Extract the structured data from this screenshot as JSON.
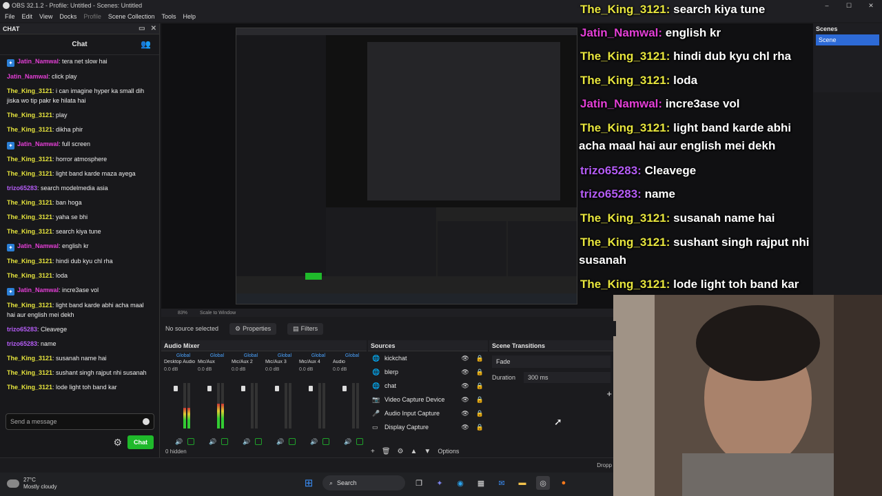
{
  "window": {
    "title": "OBS 32.1.2 - Profile: Untitled - Scenes: Untitled",
    "min": "–",
    "max": "☐",
    "close": "✕"
  },
  "menu": [
    "File",
    "Edit",
    "View",
    "Docks",
    "Profile",
    "Scene Collection",
    "Tools",
    "Help"
  ],
  "chat": {
    "dock_title": "CHAT",
    "title": "Chat",
    "messages": [
      {
        "user": "Jatin_Namwal",
        "text": "tera net slow hai",
        "color": "#e43fd6",
        "badge": true
      },
      {
        "user": "Jatin_Namwal",
        "text": "click play",
        "color": "#e43fd6",
        "badge": false
      },
      {
        "user": "The_King_3121",
        "text": "i can imagine hyper ka small dih jiska wo tip pakr ke hilata hai",
        "color": "#e7e53d",
        "badge": false
      },
      {
        "user": "The_King_3121",
        "text": "play",
        "color": "#e7e53d",
        "badge": false
      },
      {
        "user": "The_King_3121",
        "text": "dikha phir",
        "color": "#e7e53d",
        "badge": false
      },
      {
        "user": "Jatin_Namwal",
        "text": "full screen",
        "color": "#e43fd6",
        "badge": true
      },
      {
        "user": "The_King_3121",
        "text": "horror atmosphere",
        "color": "#e7e53d",
        "badge": false
      },
      {
        "user": "The_King_3121",
        "text": "light band karde maza ayega",
        "color": "#e7e53d",
        "badge": false
      },
      {
        "user": "trizo65283",
        "text": "search modelmedia asia",
        "color": "#b45cf5",
        "badge": false
      },
      {
        "user": "The_King_3121",
        "text": "ban hoga",
        "color": "#e7e53d",
        "badge": false
      },
      {
        "user": "The_King_3121",
        "text": "yaha se bhi",
        "color": "#e7e53d",
        "badge": false
      },
      {
        "user": "The_King_3121",
        "text": "search kiya tune",
        "color": "#e7e53d",
        "badge": false
      },
      {
        "user": "Jatin_Namwal",
        "text": "english kr",
        "color": "#e43fd6",
        "badge": true
      },
      {
        "user": "The_King_3121",
        "text": "hindi dub kyu chl rha",
        "color": "#e7e53d",
        "badge": false
      },
      {
        "user": "The_King_3121",
        "text": "loda",
        "color": "#e7e53d",
        "badge": false
      },
      {
        "user": "Jatin_Namwal",
        "text": "incre3ase vol",
        "color": "#e43fd6",
        "badge": true
      },
      {
        "user": "The_King_3121",
        "text": "light band karde abhi acha maal hai aur english mei dekh",
        "color": "#e7e53d",
        "badge": false
      },
      {
        "user": "trizo65283",
        "text": "Cleavege",
        "color": "#b45cf5",
        "badge": false
      },
      {
        "user": "trizo65283",
        "text": "name",
        "color": "#b45cf5",
        "badge": false
      },
      {
        "user": "The_King_3121",
        "text": "susanah name hai",
        "color": "#e7e53d",
        "badge": false
      },
      {
        "user": "The_King_3121",
        "text": "sushant singh rajput nhi susanah",
        "color": "#e7e53d",
        "badge": false
      },
      {
        "user": "The_King_3121",
        "text": "lode light toh band kar",
        "color": "#e7e53d",
        "badge": false
      }
    ],
    "input_placeholder": "Send a message",
    "send_label": "Chat"
  },
  "overlay": [
    {
      "user": "The_King_3121:",
      "text": "search kiya tune",
      "color": "#e7e53d"
    },
    {
      "user": "Jatin_Namwal:",
      "text": "english kr",
      "color": "#e43fd6"
    },
    {
      "user": "The_King_3121:",
      "text": "hindi dub kyu chl rha",
      "color": "#e7e53d"
    },
    {
      "user": "The_King_3121:",
      "text": "loda",
      "color": "#e7e53d"
    },
    {
      "user": "Jatin_Namwal:",
      "text": "incre3ase vol",
      "color": "#e43fd6"
    },
    {
      "user": "The_King_3121:",
      "text": "light band karde abhi",
      "color": "#e7e53d"
    },
    {
      "user": "",
      "text": "acha maal hai aur english mei dekh",
      "color": "#ffffff"
    },
    {
      "user": "trizo65283:",
      "text": "Cleavege",
      "color": "#b45cf5"
    },
    {
      "user": "trizo65283:",
      "text": "name",
      "color": "#b45cf5"
    },
    {
      "user": "The_King_3121:",
      "text": "susanah name hai",
      "color": "#e7e53d"
    },
    {
      "user": "The_King_3121:",
      "text": "sushant singh rajput nhi",
      "color": "#e7e53d"
    },
    {
      "user": "",
      "text": "susanah",
      "color": "#ffffff"
    },
    {
      "user": "The_King_3121:",
      "text": "lode light toh band kar",
      "color": "#e7e53d"
    }
  ],
  "scenes": {
    "title": "Scenes",
    "items": [
      "Scene"
    ]
  },
  "preview_toolbar": {
    "zoom": "83%",
    "scale_mode": "Scale to Window"
  },
  "source_bar": {
    "status": "No source selected",
    "properties": "Properties",
    "filters": "Filters"
  },
  "mixer": {
    "title": "Audio Mixer",
    "channels": [
      {
        "group": "Global",
        "name": "Desktop Audio",
        "db": "0.0 dB",
        "level": 0.45
      },
      {
        "group": "Global",
        "name": "Mic/Aux",
        "db": "0.0 dB",
        "level": 0.55
      },
      {
        "group": "Global",
        "name": "Mic/Aux 2",
        "db": "0.0 dB",
        "level": 0.0
      },
      {
        "group": "Global",
        "name": "Mic/Aux 3",
        "db": "0.0 dB",
        "level": 0.0
      },
      {
        "group": "Global",
        "name": "Mic/Aux 4",
        "db": "0.0 dB",
        "level": 0.0
      },
      {
        "group": "Global",
        "name": "Audio",
        "db": "0.0 dB",
        "level": 0.0
      }
    ],
    "scale": [
      "0",
      "-6",
      "-12",
      "-18",
      "-24",
      "-30",
      "-36",
      "-42",
      "-48",
      "-54",
      "-60"
    ],
    "hidden": "0 hidden"
  },
  "sources": {
    "title": "Sources",
    "items": [
      {
        "name": "kickchat",
        "icon": "🌐"
      },
      {
        "name": "blerp",
        "icon": "🌐"
      },
      {
        "name": "chat",
        "icon": "🌐"
      },
      {
        "name": "Video Capture Device",
        "icon": "📷"
      },
      {
        "name": "Audio Input Capture",
        "icon": "🎤"
      },
      {
        "name": "Display Capture",
        "icon": "▭"
      }
    ],
    "options": "Options"
  },
  "transitions": {
    "title": "Scene Transitions",
    "selected": "Fade",
    "duration_label": "Duration",
    "duration_value": "300 ms"
  },
  "statusbar": {
    "drop": "Dropp"
  },
  "taskbar": {
    "temp": "27°C",
    "weather": "Mostly cloudy",
    "search": "Search"
  }
}
